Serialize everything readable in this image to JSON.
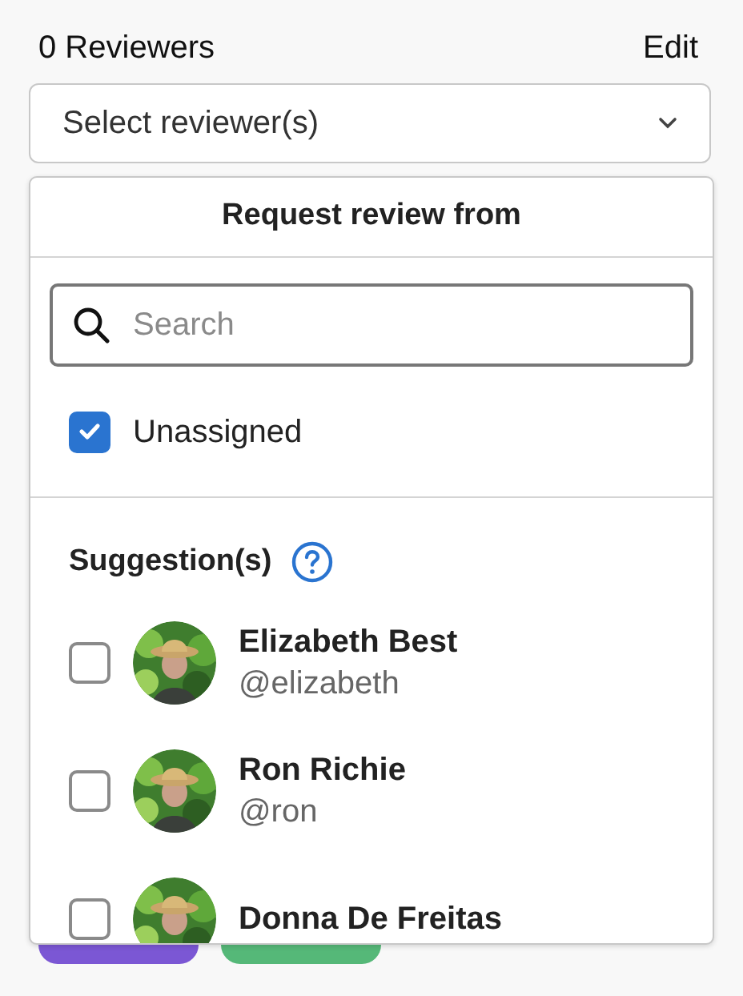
{
  "header": {
    "title": "0 Reviewers",
    "action": "Edit"
  },
  "select": {
    "placeholder": "Select reviewer(s)"
  },
  "dropdown": {
    "title": "Request review from",
    "search": {
      "placeholder": "Search"
    },
    "unassigned": {
      "label": "Unassigned",
      "checked": true
    },
    "section_title": "Suggestion(s)",
    "users": [
      {
        "name": "Elizabeth Best",
        "username": "@elizabeth",
        "checked": false
      },
      {
        "name": "Ron Richie",
        "username": "@ron",
        "checked": false
      },
      {
        "name": "Donna De Freitas",
        "checked": false
      }
    ]
  },
  "labels": [
    {
      "color": "#7b57d4"
    },
    {
      "color": "#55b878"
    }
  ]
}
